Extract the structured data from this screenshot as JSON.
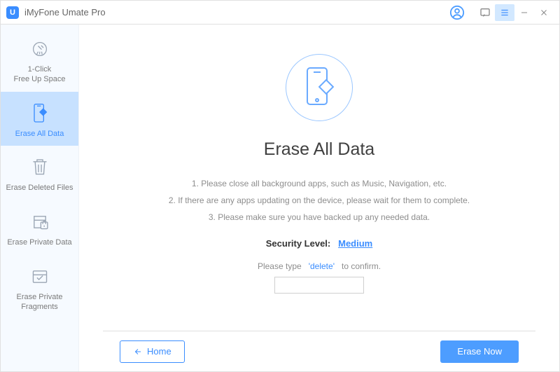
{
  "app": {
    "logo_letter": "U",
    "title": "iMyFone Umate Pro"
  },
  "sidebar": {
    "items": [
      {
        "label": "1-Click\nFree Up Space",
        "active": false
      },
      {
        "label": "Erase All Data",
        "active": true
      },
      {
        "label": "Erase Deleted Files",
        "active": false
      },
      {
        "label": "Erase Private Data",
        "active": false
      },
      {
        "label": "Erase Private\nFragments",
        "active": false
      }
    ]
  },
  "main": {
    "heading": "Erase All Data",
    "instructions": [
      "1. Please close all background apps, such as Music, Navigation, etc.",
      "2. If there are any apps updating on the device, please wait for them to complete.",
      "3. Please make sure you have backed up any needed data."
    ],
    "security_label": "Security Level:",
    "security_value": "Medium",
    "confirm_pre": "Please type",
    "confirm_keyword": "'delete'",
    "confirm_post": "to confirm.",
    "confirm_value": ""
  },
  "footer": {
    "home_label": "Home",
    "erase_label": "Erase Now"
  }
}
